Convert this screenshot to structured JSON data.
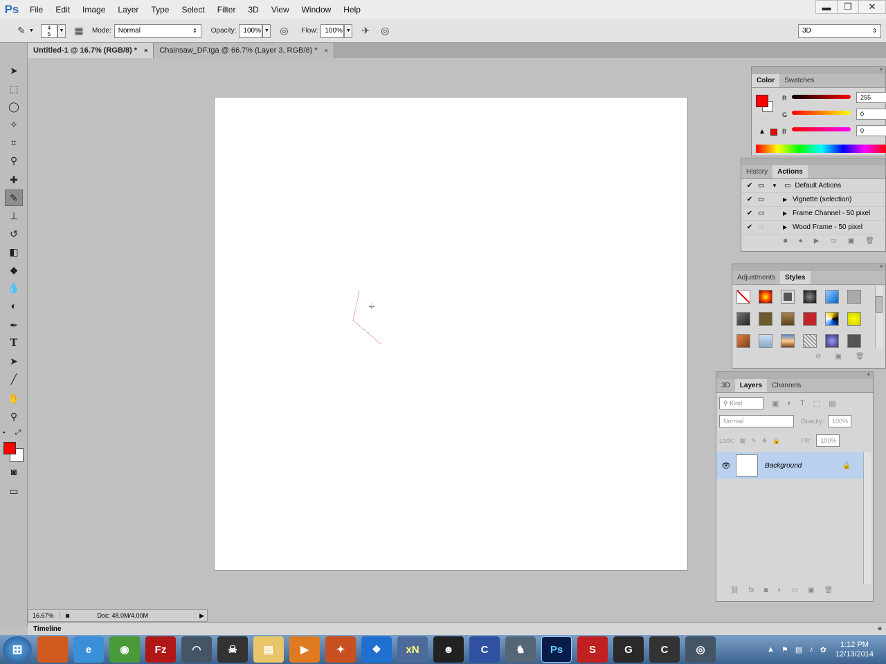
{
  "app": {
    "logo": "Ps"
  },
  "menu": [
    "File",
    "Edit",
    "Image",
    "Layer",
    "Type",
    "Select",
    "Filter",
    "3D",
    "View",
    "Window",
    "Help"
  ],
  "window_controls": {
    "minimize": "▬",
    "restore": "❐",
    "close": "✕"
  },
  "options": {
    "brush_size_top": "4",
    "brush_size_bottom": "5",
    "mode_label": "Mode:",
    "mode_value": "Normal",
    "opacity_label": "Opacity:",
    "opacity_value": "100%",
    "flow_label": "Flow:",
    "flow_value": "100%",
    "workspace": "3D"
  },
  "tabs": [
    {
      "label": "Untitled-1 @ 16.7% (RGB/8) *",
      "close": "×"
    },
    {
      "label": "Chainsaw_DF.tga @ 66.7% (Layer 3, RGB/8) *",
      "close": "×"
    }
  ],
  "status": {
    "zoom": "16.67%",
    "doc": "Doc: 48.0M/4.00M"
  },
  "timeline": {
    "label": "Timeline"
  },
  "color_panel": {
    "tabs": [
      "Color",
      "Swatches"
    ],
    "r_label": "R",
    "r_value": "255",
    "g_label": "G",
    "g_value": "0",
    "b_label": "B",
    "b_value": "0",
    "foreground": "#ff0000"
  },
  "history_panel": {
    "tabs": [
      "History",
      "Actions"
    ],
    "rows": [
      {
        "label": "Default Actions",
        "arrow": "▼"
      },
      {
        "label": "Vignette (selection)",
        "arrow": "▶"
      },
      {
        "label": "Frame Channel - 50 pixel",
        "arrow": "▶"
      },
      {
        "label": "Wood Frame - 50 pixel",
        "arrow": "▶"
      }
    ]
  },
  "adjust_panel": {
    "tabs": [
      "Adjustments",
      "Styles"
    ]
  },
  "layers_panel": {
    "tabs": [
      "3D",
      "Layers",
      "Channels"
    ],
    "kind_label": "Kind",
    "blend_mode": "Normal",
    "opacity_label": "Opacity:",
    "opacity_value": "100%",
    "lock_label": "Lock:",
    "fill_label": "Fill:",
    "fill_value": "100%",
    "layer_name": "Background"
  },
  "taskbar": {
    "apps": [
      "e",
      "◉",
      "Fz",
      "◠",
      "☠",
      "▤",
      "▶",
      "✦",
      "❖",
      "xN",
      "☻",
      "C",
      "♞",
      "Ps",
      "S",
      "G",
      "C",
      "◎"
    ],
    "time": "1:12 PM",
    "date": "12/13/2014"
  },
  "colors": {
    "accent": "#ff0000",
    "selection": "#b9d1ef",
    "taskbar": "#4a72a0"
  }
}
